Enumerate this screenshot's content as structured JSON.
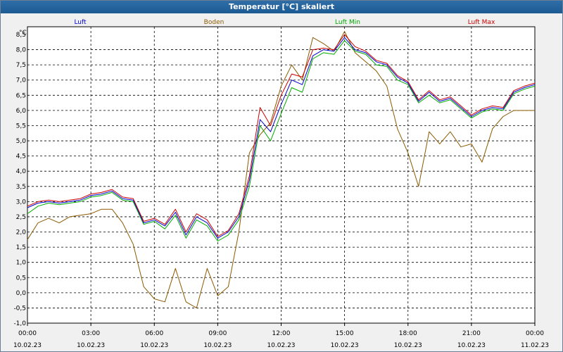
{
  "window": {
    "title": "Temperatur [°C] skaliert"
  },
  "colors": {
    "luft": "#0000cc",
    "boden": "#8b5a00",
    "luft_min": "#00aa00",
    "luft_max": "#cc0000",
    "grid": "#000000"
  },
  "chart_data": {
    "type": "line",
    "title": "Temperatur [°C] skaliert",
    "ylabel": "°C",
    "xlabel": "",
    "ylim": [
      -1.0,
      8.5
    ],
    "grid": true,
    "legend_position": "top",
    "yticks": [
      "8,5",
      "8,0",
      "7,5",
      "7,0",
      "6,5",
      "6,0",
      "5,5",
      "5,0",
      "4,5",
      "4,0",
      "3,5",
      "3,0",
      "2,5",
      "2,0",
      "1,5",
      "1,0",
      "0,5",
      "0,0",
      "-0,5",
      "-1,0"
    ],
    "xticks": [
      {
        "time": "00:00",
        "date": "10.02.23"
      },
      {
        "time": "03:00",
        "date": "10.02.23"
      },
      {
        "time": "06:00",
        "date": "10.02.23"
      },
      {
        "time": "09:00",
        "date": "10.02.23"
      },
      {
        "time": "12:00",
        "date": "10.02.23"
      },
      {
        "time": "15:00",
        "date": "10.02.23"
      },
      {
        "time": "18:00",
        "date": "10.02.23"
      },
      {
        "time": "21:00",
        "date": "10.02.23"
      },
      {
        "time": "00:00",
        "date": "11.02.23"
      }
    ],
    "x_hours": [
      0,
      0.5,
      1,
      1.5,
      2,
      2.5,
      3,
      3.5,
      4,
      4.5,
      5,
      5.5,
      6,
      6.5,
      7,
      7.5,
      8,
      8.5,
      9,
      9.5,
      10,
      10.5,
      11,
      11.5,
      12,
      12.5,
      13,
      13.5,
      14,
      14.5,
      15,
      15.5,
      16,
      16.5,
      17,
      17.5,
      18,
      18.5,
      19,
      19.5,
      20,
      20.5,
      21,
      21.5,
      22,
      22.5,
      23,
      23.5,
      24
    ],
    "series": [
      {
        "name": "Luft",
        "color": "#0000cc",
        "values": [
          2.8,
          2.95,
          3.0,
          2.95,
          3.0,
          3.05,
          3.2,
          3.25,
          3.35,
          3.1,
          3.05,
          2.3,
          2.4,
          2.2,
          2.65,
          1.9,
          2.5,
          2.3,
          1.8,
          2.0,
          2.5,
          3.7,
          5.7,
          5.3,
          6.2,
          7.0,
          6.85,
          7.8,
          8.0,
          7.95,
          8.4,
          8.0,
          7.9,
          7.6,
          7.5,
          7.1,
          6.9,
          6.3,
          6.6,
          6.3,
          6.4,
          6.1,
          5.8,
          6.0,
          6.1,
          6.05,
          6.6,
          6.75,
          6.85
        ]
      },
      {
        "name": "Boden",
        "color": "#8b5a00",
        "values": [
          1.75,
          2.3,
          2.45,
          2.3,
          2.5,
          2.55,
          2.6,
          2.75,
          2.75,
          2.3,
          1.6,
          0.2,
          -0.2,
          -0.3,
          0.8,
          -0.3,
          -0.5,
          0.8,
          -0.1,
          0.2,
          2.0,
          4.6,
          5.2,
          5.6,
          6.8,
          7.5,
          7.0,
          8.4,
          8.2,
          7.95,
          8.6,
          7.9,
          7.6,
          7.3,
          6.8,
          5.4,
          4.6,
          3.5,
          5.3,
          4.9,
          5.3,
          4.8,
          4.9,
          4.3,
          5.4,
          5.8,
          6.0,
          6.0,
          6.0
        ]
      },
      {
        "name": "Luft Min",
        "color": "#00aa00",
        "values": [
          2.6,
          2.85,
          2.95,
          2.9,
          2.95,
          3.0,
          3.15,
          3.2,
          3.3,
          3.05,
          3.0,
          2.25,
          2.35,
          2.1,
          2.55,
          1.8,
          2.4,
          2.2,
          1.7,
          1.9,
          2.4,
          3.5,
          5.5,
          5.0,
          5.9,
          6.75,
          6.6,
          7.7,
          7.9,
          7.85,
          8.3,
          7.95,
          7.85,
          7.5,
          7.45,
          7.0,
          6.85,
          6.25,
          6.5,
          6.25,
          6.35,
          6.05,
          5.75,
          5.95,
          6.05,
          6.0,
          6.55,
          6.7,
          6.8
        ]
      },
      {
        "name": "Luft Max",
        "color": "#cc0000",
        "values": [
          2.85,
          3.0,
          3.05,
          3.0,
          3.05,
          3.1,
          3.25,
          3.3,
          3.4,
          3.15,
          3.1,
          2.35,
          2.45,
          2.25,
          2.75,
          2.0,
          2.6,
          2.4,
          1.85,
          2.05,
          2.6,
          3.85,
          6.1,
          5.5,
          6.5,
          7.2,
          7.1,
          8.0,
          8.05,
          8.0,
          8.5,
          8.1,
          7.95,
          7.65,
          7.55,
          7.15,
          6.95,
          6.35,
          6.65,
          6.35,
          6.45,
          6.15,
          5.85,
          6.05,
          6.15,
          6.1,
          6.65,
          6.8,
          6.9
        ]
      }
    ]
  }
}
